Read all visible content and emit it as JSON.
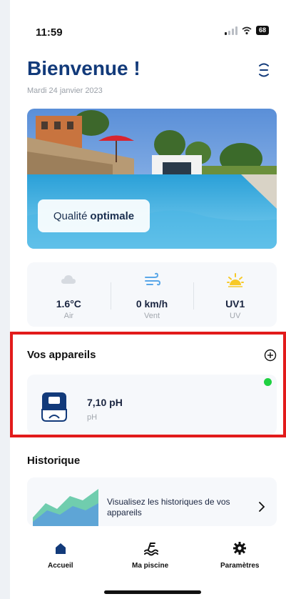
{
  "status_bar": {
    "time": "11:59",
    "battery": "68"
  },
  "header": {
    "title": "Bienvenue !",
    "date": "Mardi 24 janvier 2023"
  },
  "hero": {
    "quality_prefix": "Qualité",
    "quality_value": "optimale"
  },
  "weather": [
    {
      "icon": "cloud-icon",
      "value": "1.6°C",
      "label": "Air"
    },
    {
      "icon": "wind-icon",
      "value": "0 km/h",
      "label": "Vent"
    },
    {
      "icon": "sun-icon",
      "value": "UV1",
      "label": "UV"
    }
  ],
  "devices": {
    "title": "Vos appareils",
    "items": [
      {
        "value": "7,10 pH",
        "unit": "pH",
        "status_color": "#1fd141"
      }
    ]
  },
  "history": {
    "title": "Historique",
    "text": "Visualisez les historiques de vos appareils"
  },
  "nav": [
    {
      "label": "Accueil",
      "icon": "home-icon"
    },
    {
      "label": "Ma piscine",
      "icon": "pool-icon"
    },
    {
      "label": "Paramètres",
      "icon": "settings-icon"
    }
  ],
  "colors": {
    "brand": "#123a7a",
    "accent_highlight": "#e21b1b",
    "status_ok": "#1fd141"
  }
}
